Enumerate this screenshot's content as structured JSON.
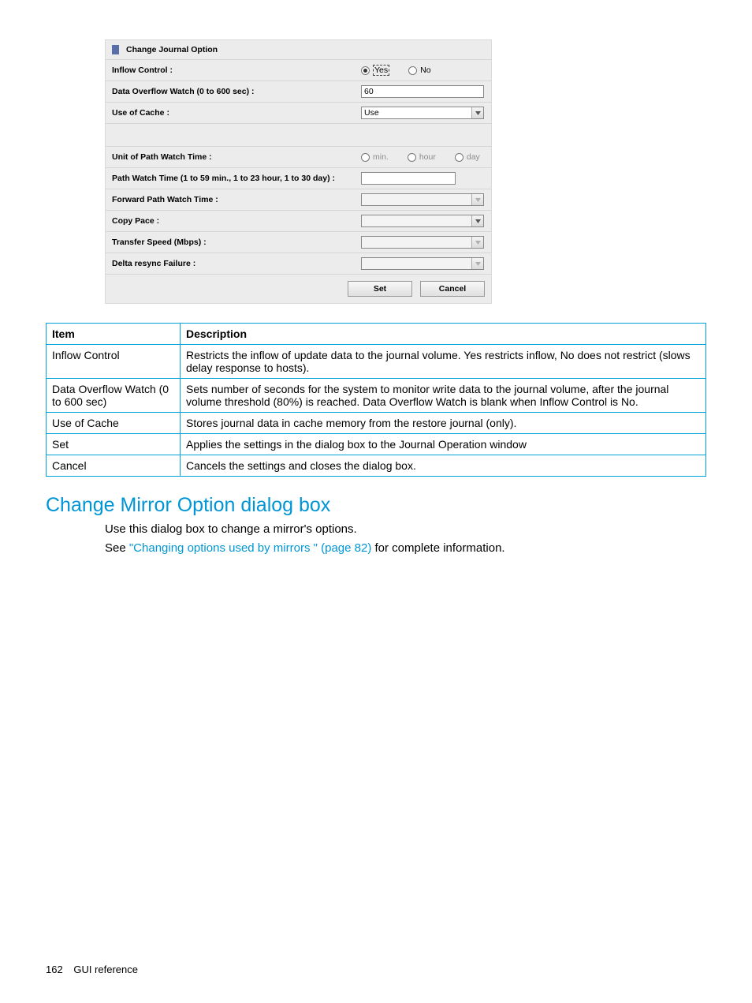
{
  "dialog": {
    "title": "Change Journal Option",
    "rows": {
      "inflow": {
        "label": "Inflow Control :",
        "yes": "Yes",
        "no": "No"
      },
      "overflow": {
        "label": "Data Overflow Watch (0 to 600 sec) :",
        "value": "60"
      },
      "cache": {
        "label": "Use of Cache :",
        "value": "Use"
      },
      "unit": {
        "label": "Unit of Path Watch Time :",
        "min": "min.",
        "hour": "hour",
        "day": "day"
      },
      "pwt": {
        "label": "Path Watch Time (1 to 59 min., 1 to 23 hour, 1 to 30 day) :"
      },
      "fpwt": {
        "label": "Forward Path Watch Time :"
      },
      "copy": {
        "label": "Copy Pace :"
      },
      "speed": {
        "label": "Transfer Speed (Mbps) :"
      },
      "delta": {
        "label": "Delta resync Failure :"
      }
    },
    "buttons": {
      "set": "Set",
      "cancel": "Cancel"
    }
  },
  "table": {
    "headers": {
      "item": "Item",
      "desc": "Description"
    },
    "rows": [
      {
        "item": "Inflow Control",
        "desc": "Restricts the inflow of update data to the journal volume. Yes restricts inflow, No does not restrict (slows delay response to hosts)."
      },
      {
        "item": "Data Overflow Watch (0 to 600 sec)",
        "desc": "Sets number of seconds for the system to monitor write data to the journal volume, after the journal volume threshold (80%) is reached. Data Overflow Watch is blank when Inflow Control is No."
      },
      {
        "item": "Use of Cache",
        "desc": "Stores journal data in cache memory from the restore journal (only)."
      },
      {
        "item": "Set",
        "desc": "Applies the settings in the dialog box to the Journal Operation window"
      },
      {
        "item": "Cancel",
        "desc": "Cancels the settings and closes the dialog box."
      }
    ]
  },
  "section": {
    "heading": "Change Mirror Option dialog box",
    "p1": "Use this dialog box to change a mirror's options.",
    "p2a": "See ",
    "link": "\"Changing options used by mirrors \" (page 82)",
    "p2b": " for complete information."
  },
  "footer": {
    "page": "162",
    "text": "GUI reference"
  }
}
